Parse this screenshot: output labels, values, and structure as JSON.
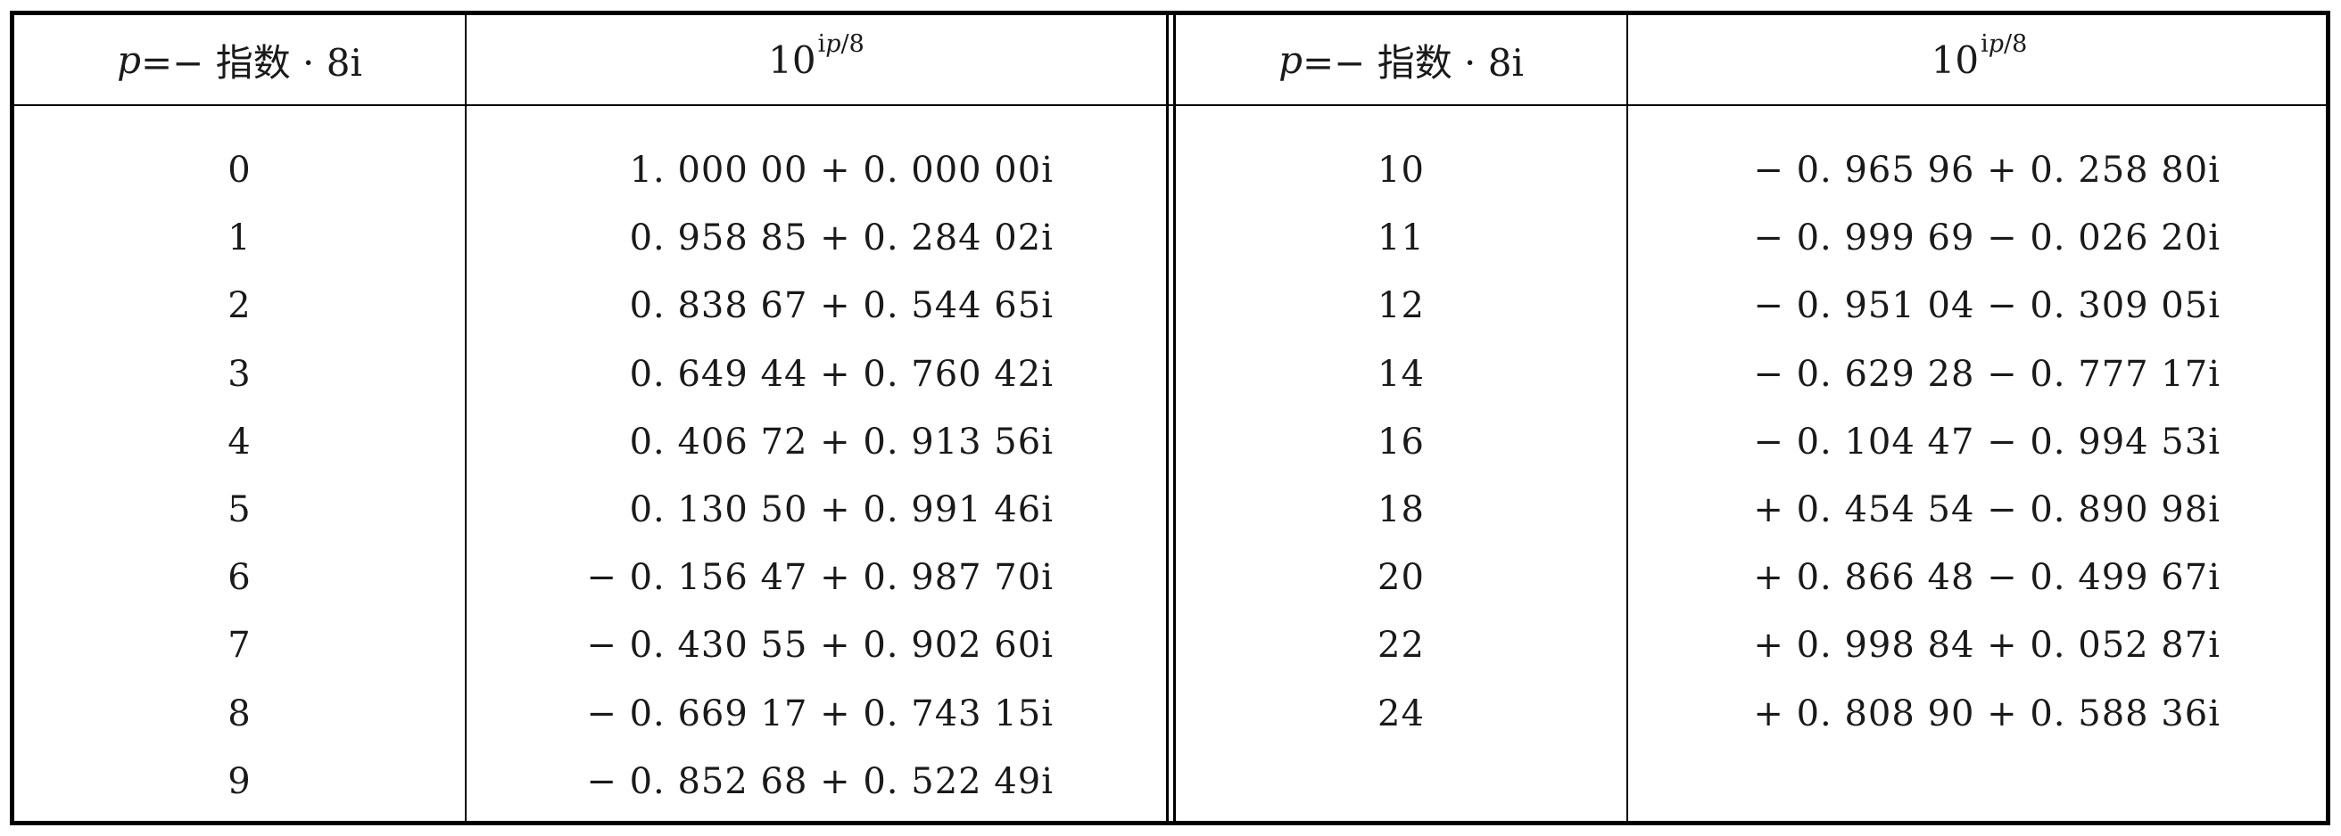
{
  "table": {
    "headers": {
      "index_col": "p =− 指数 · 8i",
      "index_col_p": "p",
      "index_col_rest": " =− 指数 · 8i",
      "value_base": "10",
      "value_sup_i": "i",
      "value_sup_p": "p",
      "value_sup_rest": "/8"
    },
    "left_rows": [
      {
        "p": "0",
        "value": "1. 000 00 + 0. 000 00i"
      },
      {
        "p": "1",
        "value": "0. 958 85 + 0. 284 02i"
      },
      {
        "p": "2",
        "value": "0. 838 67 + 0. 544 65i"
      },
      {
        "p": "3",
        "value": "0. 649 44 + 0. 760 42i"
      },
      {
        "p": "4",
        "value": "0. 406 72 + 0. 913 56i"
      },
      {
        "p": "5",
        "value": "0. 130 50 + 0. 991 46i"
      },
      {
        "p": "6",
        "value": "− 0. 156 47 + 0. 987 70i"
      },
      {
        "p": "7",
        "value": "− 0. 430 55 + 0. 902 60i"
      },
      {
        "p": "8",
        "value": "− 0. 669 17 + 0. 743 15i"
      },
      {
        "p": "9",
        "value": "− 0. 852 68 + 0. 522 49i"
      }
    ],
    "right_rows": [
      {
        "p": "10",
        "value": "− 0. 965 96 + 0. 258 80i"
      },
      {
        "p": "11",
        "value": "− 0. 999 69 − 0. 026 20i"
      },
      {
        "p": "12",
        "value": "− 0. 951 04 − 0. 309 05i"
      },
      {
        "p": "14",
        "value": "− 0. 629 28 − 0. 777 17i"
      },
      {
        "p": "16",
        "value": "− 0. 104 47 − 0. 994 53i"
      },
      {
        "p": "18",
        "value": "+ 0. 454 54 − 0. 890 98i"
      },
      {
        "p": "20",
        "value": "+ 0. 866 48 − 0. 499 67i"
      },
      {
        "p": "22",
        "value": "+ 0. 998 84 + 0. 052 87i"
      },
      {
        "p": "24",
        "value": "+ 0. 808 90 + 0. 588 36i"
      }
    ]
  }
}
